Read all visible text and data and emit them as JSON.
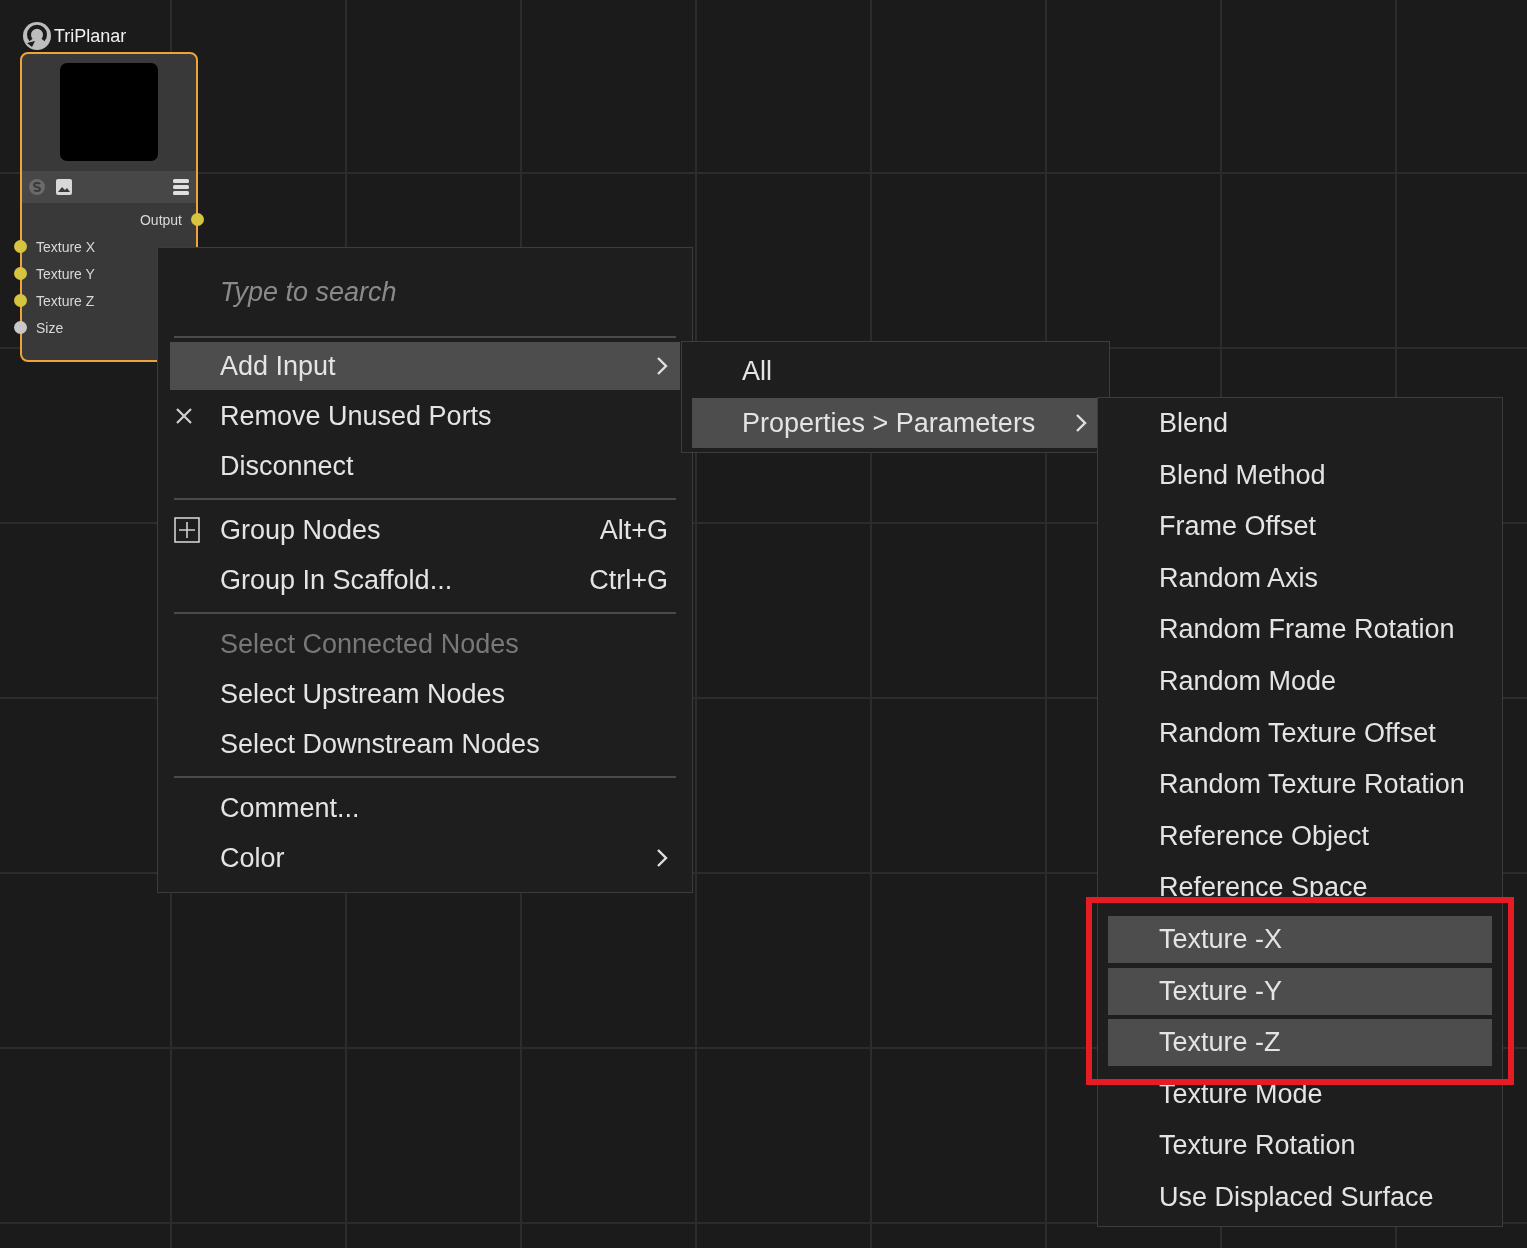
{
  "node": {
    "title": "TriPlanar",
    "output": {
      "label": "Output",
      "color": "#d6c340"
    },
    "inputs": [
      {
        "label": "Texture X",
        "color": "#d6c340"
      },
      {
        "label": "Texture Y",
        "color": "#d6c340"
      },
      {
        "label": "Texture Z",
        "color": "#d6c340"
      },
      {
        "label": "Size",
        "color": "#c8c8c8"
      }
    ]
  },
  "context_menu": {
    "search": {
      "placeholder": "Type to search"
    },
    "sections": [
      [
        {
          "label": "Add Input",
          "kind": "plain",
          "submenu": true,
          "selected": true,
          "disabled": false
        },
        {
          "label": "Remove Unused Ports",
          "kind": "close",
          "submenu": false,
          "selected": false,
          "disabled": false
        },
        {
          "label": "Disconnect",
          "kind": "plain",
          "submenu": false,
          "selected": false,
          "disabled": false
        }
      ],
      [
        {
          "label": "Group Nodes",
          "kind": "group",
          "shortcut": "Alt+G",
          "submenu": false,
          "selected": false,
          "disabled": false
        },
        {
          "label": "Group In Scaffold...",
          "kind": "plain",
          "shortcut": "Ctrl+G",
          "submenu": false,
          "selected": false,
          "disabled": false
        }
      ],
      [
        {
          "label": "Select Connected Nodes",
          "kind": "plain",
          "submenu": false,
          "selected": false,
          "disabled": true
        },
        {
          "label": "Select Upstream Nodes",
          "kind": "plain",
          "submenu": false,
          "selected": false,
          "disabled": false
        },
        {
          "label": "Select Downstream Nodes",
          "kind": "plain",
          "submenu": false,
          "selected": false,
          "disabled": false
        }
      ],
      [
        {
          "label": "Comment...",
          "kind": "plain",
          "submenu": false,
          "selected": false,
          "disabled": false
        },
        {
          "label": "Color",
          "kind": "plain",
          "submenu": true,
          "selected": false,
          "disabled": false
        }
      ]
    ]
  },
  "submenu": {
    "items": [
      {
        "label": "All",
        "submenu": false,
        "selected": false
      },
      {
        "label": "Properties > Parameters",
        "submenu": true,
        "selected": true
      }
    ]
  },
  "parameters_menu": {
    "items": [
      {
        "label": "Blend",
        "selected": false
      },
      {
        "label": "Blend Method",
        "selected": false
      },
      {
        "label": "Frame Offset",
        "selected": false
      },
      {
        "label": "Random Axis",
        "selected": false
      },
      {
        "label": "Random Frame Rotation",
        "selected": false
      },
      {
        "label": "Random Mode",
        "selected": false
      },
      {
        "label": "Random Texture Offset",
        "selected": false
      },
      {
        "label": "Random Texture Rotation",
        "selected": false
      },
      {
        "label": "Reference Object",
        "selected": false
      },
      {
        "label": "Reference Space",
        "selected": false
      },
      {
        "label": "Texture -X",
        "selected": true
      },
      {
        "label": "Texture -Y",
        "selected": true
      },
      {
        "label": "Texture -Z",
        "selected": true
      },
      {
        "label": "Texture Mode",
        "selected": false
      },
      {
        "label": "Texture Rotation",
        "selected": false
      },
      {
        "label": "Use Displaced Surface",
        "selected": false
      }
    ]
  }
}
